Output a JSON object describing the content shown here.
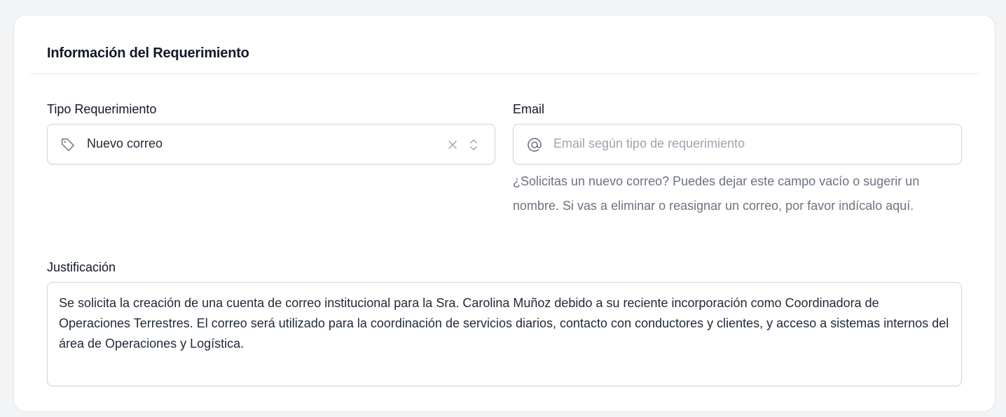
{
  "section": {
    "title": "Información del Requerimiento"
  },
  "tipo_requerimiento": {
    "label": "Tipo Requerimiento",
    "value": "Nuevo correo",
    "icon": "tag-icon"
  },
  "email": {
    "label": "Email",
    "placeholder": "Email según tipo de requerimiento",
    "icon": "at-icon",
    "helper": "¿Solicitas un nuevo correo? Puedes dejar este campo vacío o sugerir un nombre. Si vas a eliminar o reasignar un correo, por favor indícalo aquí."
  },
  "justificacion": {
    "label": "Justificación",
    "value": "Se solicita la creación de una cuenta de correo institucional para la Sra. Carolina Muñoz debido a su reciente incorporación como Coordinadora de Operaciones Terrestres. El correo será utilizado para la coordinación de servicios diarios, contacto con conductores y clientes, y acceso a sistemas internos del área de Operaciones y Logística."
  },
  "colors": {
    "text": "#1f2937",
    "muted": "#6b7280",
    "border": "#d1d5db",
    "background": "#f3f4f6"
  }
}
